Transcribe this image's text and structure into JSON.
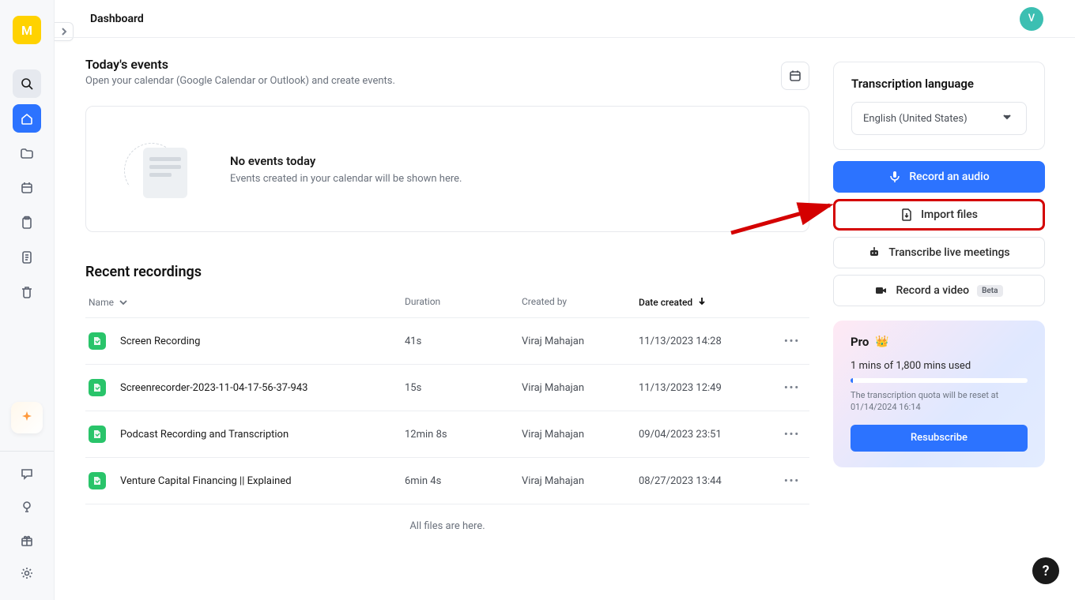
{
  "header": {
    "title": "Dashboard",
    "avatar_initial": "V"
  },
  "nav": {
    "logo_initial": "M"
  },
  "events": {
    "title": "Today's events",
    "subtitle": "Open your calendar (Google Calendar or Outlook) and create events.",
    "empty_title": "No events today",
    "empty_subtitle": "Events created in your calendar will be shown here."
  },
  "recordings": {
    "title": "Recent recordings",
    "columns": {
      "name": "Name",
      "duration": "Duration",
      "created_by": "Created by",
      "date_created": "Date created"
    },
    "rows": [
      {
        "name": "Screen Recording",
        "duration": "41s",
        "created_by": "Viraj Mahajan",
        "date": "11/13/2023 14:28"
      },
      {
        "name": "Screenrecorder-2023-11-04-17-56-37-943",
        "duration": "15s",
        "created_by": "Viraj Mahajan",
        "date": "11/13/2023 12:49"
      },
      {
        "name": "Podcast Recording and Transcription",
        "duration": "12min 8s",
        "created_by": "Viraj Mahajan",
        "date": "09/04/2023 23:51"
      },
      {
        "name": "Venture Capital Financing || Explained",
        "duration": "6min 4s",
        "created_by": "Viraj Mahajan",
        "date": "08/27/2023 13:44"
      }
    ],
    "footer": "All files are here."
  },
  "side": {
    "lang_title": "Transcription language",
    "lang_value": "English (United States)",
    "record_audio": "Record an audio",
    "import_files": "Import files",
    "transcribe_live": "Transcribe live meetings",
    "record_video": "Record a video",
    "beta": "Beta"
  },
  "plan": {
    "name": "Pro",
    "usage": "1 mins of 1,800 mins used",
    "quota_note": "The transcription quota will be reset at 01/14/2024 16:14",
    "cta": "Resubscribe"
  },
  "help": "?"
}
